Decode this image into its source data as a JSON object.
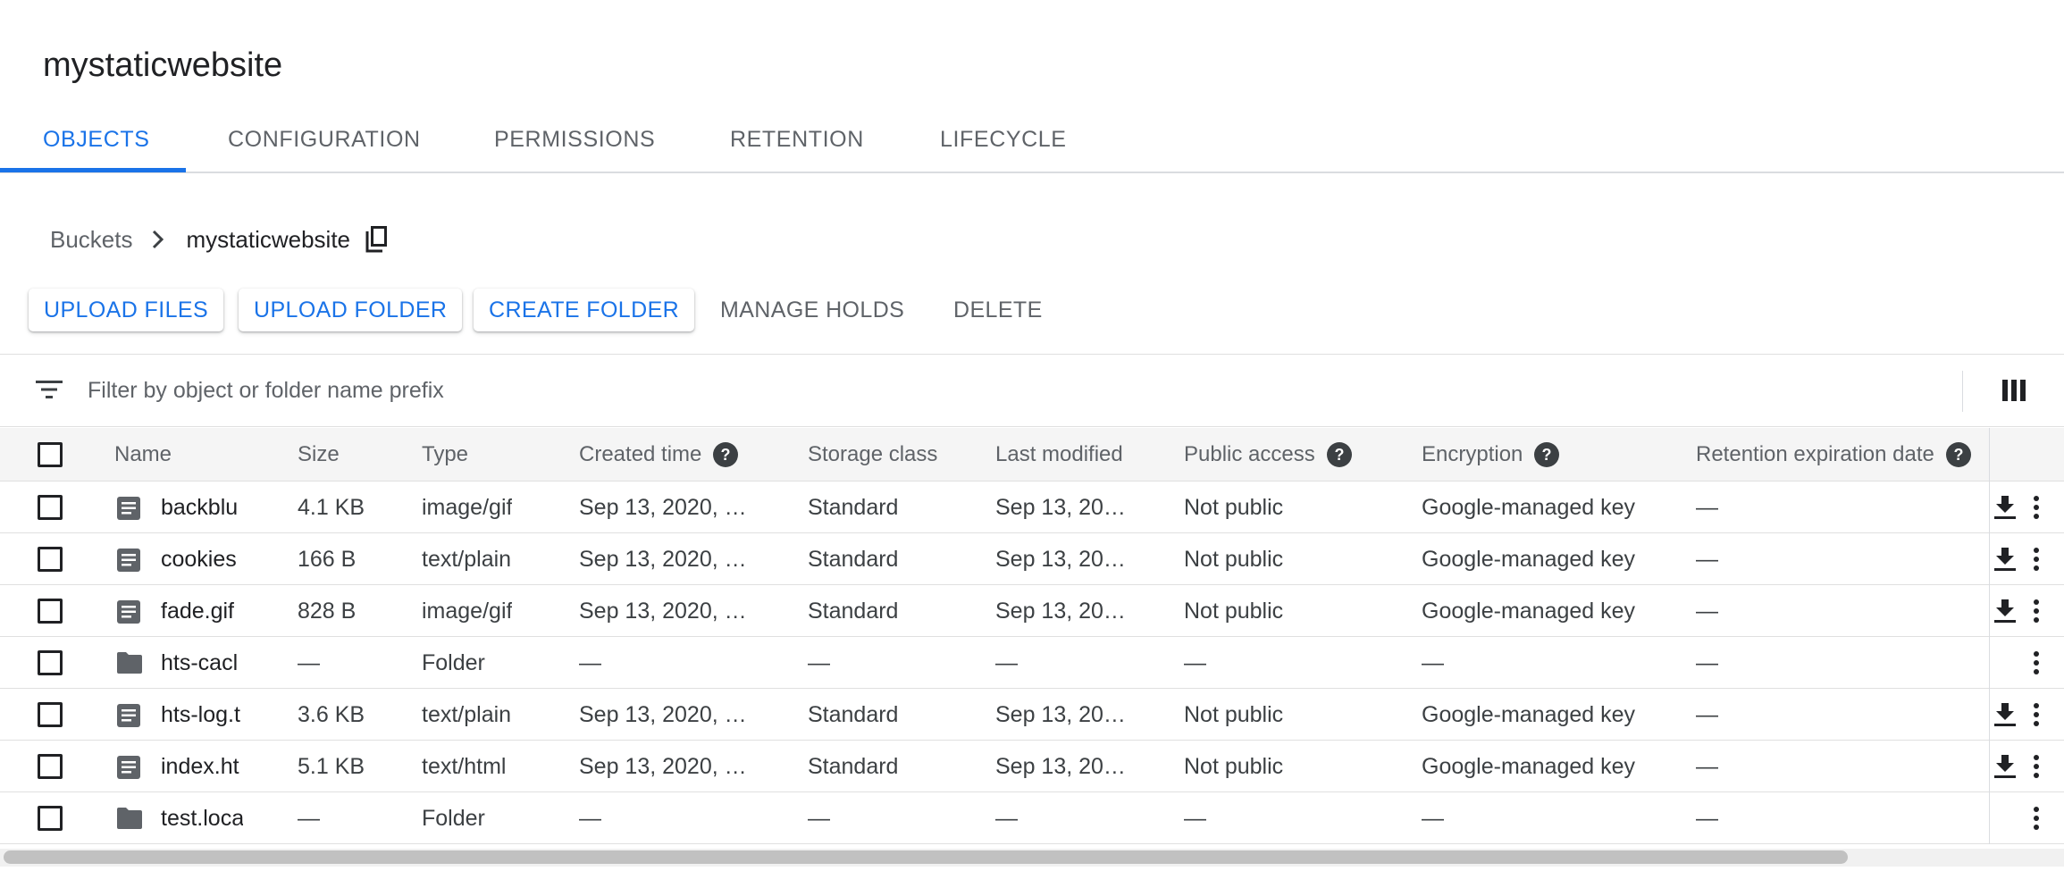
{
  "bucket_title": "mystaticwebsite",
  "tabs": [
    {
      "label": "OBJECTS",
      "active": true
    },
    {
      "label": "CONFIGURATION",
      "active": false
    },
    {
      "label": "PERMISSIONS",
      "active": false
    },
    {
      "label": "RETENTION",
      "active": false
    },
    {
      "label": "LIFECYCLE",
      "active": false
    }
  ],
  "breadcrumb": {
    "root": "Buckets",
    "current": "mystaticwebsite",
    "separator_icon": "chevron-right-icon",
    "copy_icon": "copy-icon"
  },
  "toolbar": {
    "upload_files": "UPLOAD FILES",
    "upload_folder": "UPLOAD FOLDER",
    "create_folder": "CREATE FOLDER",
    "manage_holds": "MANAGE HOLDS",
    "delete": "DELETE"
  },
  "filter": {
    "placeholder": "Filter by object or folder name prefix",
    "value": "",
    "filter_icon": "filter-list-icon",
    "columns_icon": "column-view-icon"
  },
  "table": {
    "columns": {
      "name": "Name",
      "size": "Size",
      "type": "Type",
      "created": "Created time",
      "storage": "Storage class",
      "modified": "Last modified",
      "public": "Public access",
      "encryption": "Encryption",
      "retention": "Retention expiration date"
    },
    "rows": [
      {
        "kind": "file",
        "name": "backblu",
        "size": "4.1 KB",
        "type": "image/gif",
        "created": "Sep 13, 2020, …",
        "storage": "Standard",
        "modified": "Sep 13, 20…",
        "public": "Not public",
        "encryption": "Google-managed key",
        "retention": "—"
      },
      {
        "kind": "file",
        "name": "cookies",
        "size": "166 B",
        "type": "text/plain",
        "created": "Sep 13, 2020, …",
        "storage": "Standard",
        "modified": "Sep 13, 20…",
        "public": "Not public",
        "encryption": "Google-managed key",
        "retention": "—"
      },
      {
        "kind": "file",
        "name": "fade.gif",
        "size": "828 B",
        "type": "image/gif",
        "created": "Sep 13, 2020, …",
        "storage": "Standard",
        "modified": "Sep 13, 20…",
        "public": "Not public",
        "encryption": "Google-managed key",
        "retention": "—"
      },
      {
        "kind": "folder",
        "name": "hts-cacl",
        "size": "—",
        "type": "Folder",
        "created": "—",
        "storage": "—",
        "modified": "—",
        "public": "—",
        "encryption": "—",
        "retention": "—"
      },
      {
        "kind": "file",
        "name": "hts-log.t",
        "size": "3.6 KB",
        "type": "text/plain",
        "created": "Sep 13, 2020, …",
        "storage": "Standard",
        "modified": "Sep 13, 20…",
        "public": "Not public",
        "encryption": "Google-managed key",
        "retention": "—"
      },
      {
        "kind": "file",
        "name": "index.ht",
        "size": "5.1 KB",
        "type": "text/html",
        "created": "Sep 13, 2020, …",
        "storage": "Standard",
        "modified": "Sep 13, 20…",
        "public": "Not public",
        "encryption": "Google-managed key",
        "retention": "—"
      },
      {
        "kind": "folder",
        "name": "test.loca",
        "size": "—",
        "type": "Folder",
        "created": "—",
        "storage": "—",
        "modified": "—",
        "public": "—",
        "encryption": "—",
        "retention": "—"
      }
    ]
  },
  "colors": {
    "accent": "#1a73e8",
    "text_primary": "#202124",
    "text_secondary": "#5f6368",
    "header_bg": "#f5f5f5",
    "divider": "#e0e0e0"
  }
}
